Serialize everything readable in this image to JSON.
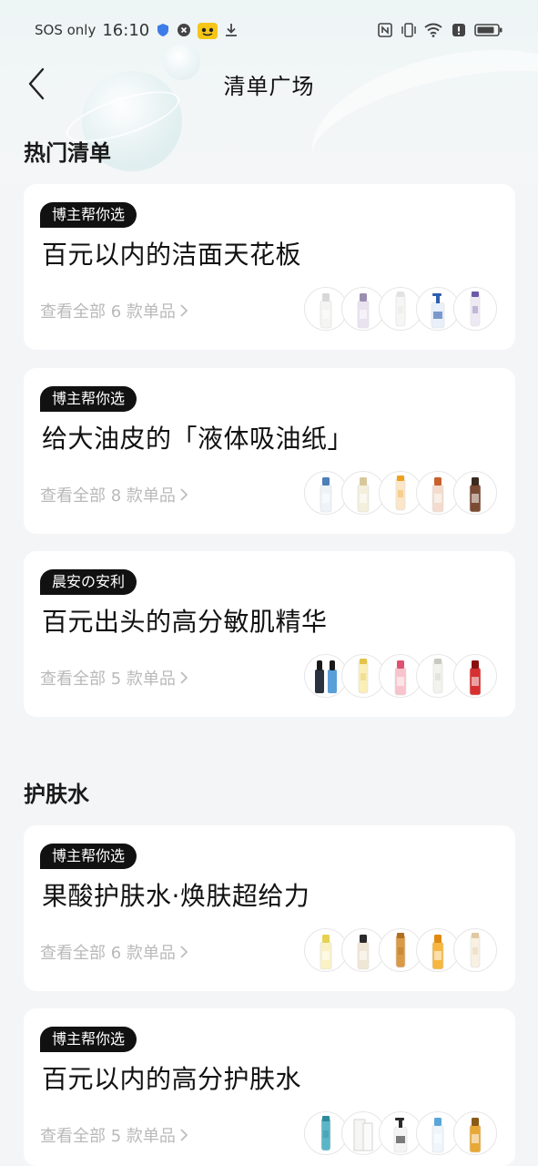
{
  "status_bar": {
    "carrier": "SOS only",
    "time": "16:10"
  },
  "nav": {
    "title": "清单广场"
  },
  "sections": [
    {
      "title": "热门清单",
      "cards": [
        {
          "tag": "博主帮你选",
          "title": "百元以内的洁面天花板",
          "view_all": "查看全部 6 款单品",
          "thumbs": [
            {
              "icon": "white-tube-bottle-icon",
              "body": "#f4f4f2",
              "cap": "#d8d8d8",
              "kind": "bottle"
            },
            {
              "icon": "lavender-bottle-icon",
              "body": "#e9e2ef",
              "cap": "#9b8fb0",
              "kind": "bottle"
            },
            {
              "icon": "white-tube-icon",
              "body": "#f6f6f4",
              "cap": "#e2e2e2",
              "kind": "tube"
            },
            {
              "icon": "pump-bottle-icon",
              "body": "#e9f0fa",
              "cap": "#2e5fb0",
              "kind": "pump"
            },
            {
              "icon": "purple-tube-icon",
              "body": "#eeeaf4",
              "cap": "#6d5aa7",
              "kind": "tube"
            }
          ]
        },
        {
          "tag": "博主帮你选",
          "title": "给大油皮的「液体吸油纸」",
          "view_all": "查看全部 8 款单品",
          "thumbs": [
            {
              "icon": "blue-label-bottle-icon",
              "body": "#eef3f8",
              "cap": "#4d7fb8",
              "kind": "bottle"
            },
            {
              "icon": "clear-oil-bottle-icon",
              "body": "#f3efdc",
              "cap": "#d9c79c",
              "kind": "bottle"
            },
            {
              "icon": "orange-bottle-icon",
              "body": "#fbe6c8",
              "cap": "#f0a020",
              "kind": "tube"
            },
            {
              "icon": "amber-serum-icon",
              "body": "#f3dccd",
              "cap": "#c8612d",
              "kind": "bottle"
            },
            {
              "icon": "brown-bottle-icon",
              "body": "#7a4a34",
              "cap": "#3a2a20",
              "kind": "bottle"
            }
          ]
        },
        {
          "tag": "晨安の安利",
          "title": "百元出头的高分敏肌精华",
          "view_all": "查看全部 5 款单品",
          "thumbs": [
            {
              "icon": "dropper-pair-icon",
              "body": "#2a3240",
              "cap": "#5aa0d8",
              "kind": "dropper"
            },
            {
              "icon": "yellow-ampoule-icon",
              "body": "#fbefb8",
              "cap": "#e3c34a",
              "kind": "tube"
            },
            {
              "icon": "pink-bottle-icon",
              "body": "#f7c4cc",
              "cap": "#e05070",
              "kind": "bottle"
            },
            {
              "icon": "white-essence-icon",
              "body": "#f2f2ee",
              "cap": "#c9c9c2",
              "kind": "tube"
            },
            {
              "icon": "red-essence-icon",
              "body": "#d63030",
              "cap": "#8a1010",
              "kind": "bottle"
            }
          ]
        }
      ]
    },
    {
      "title": "护肤水",
      "cards": [
        {
          "tag": "博主帮你选",
          "title": "果酸护肤水·焕肤超给力",
          "view_all": "查看全部 6 款单品",
          "thumbs": [
            {
              "icon": "yellow-toner-icon",
              "body": "#faf2c4",
              "cap": "#e6d250",
              "kind": "bottle"
            },
            {
              "icon": "black-cap-toner-icon",
              "body": "#efe6d6",
              "cap": "#2a2a2a",
              "kind": "bottle"
            },
            {
              "icon": "amber-toner-icon",
              "body": "#d99a48",
              "cap": "#b07020",
              "kind": "tube"
            },
            {
              "icon": "orange-toner-icon",
              "body": "#f6b640",
              "cap": "#e08a10",
              "kind": "bottle"
            },
            {
              "icon": "cream-toner-icon",
              "body": "#f8f0e2",
              "cap": "#e0c8a0",
              "kind": "tube"
            }
          ]
        },
        {
          "tag": "博主帮你选",
          "title": "百元以内的高分护肤水",
          "view_all": "查看全部 5 款单品",
          "thumbs": [
            {
              "icon": "teal-tube-icon",
              "body": "#5ab6c6",
              "cap": "#2d8a9c",
              "kind": "tube"
            },
            {
              "icon": "white-box-icon",
              "body": "#f6f6f4",
              "cap": "#e2e2e2",
              "kind": "box"
            },
            {
              "icon": "pump-toner-icon",
              "body": "#f4f4f4",
              "cap": "#2a2a2a",
              "kind": "pump"
            },
            {
              "icon": "blue-label-toner-icon",
              "body": "#eef5fb",
              "cap": "#5aa6d8",
              "kind": "bottle"
            },
            {
              "icon": "gold-bottle-icon",
              "body": "#e8a838",
              "cap": "#8a5a18",
              "kind": "bottle"
            }
          ]
        }
      ]
    }
  ]
}
